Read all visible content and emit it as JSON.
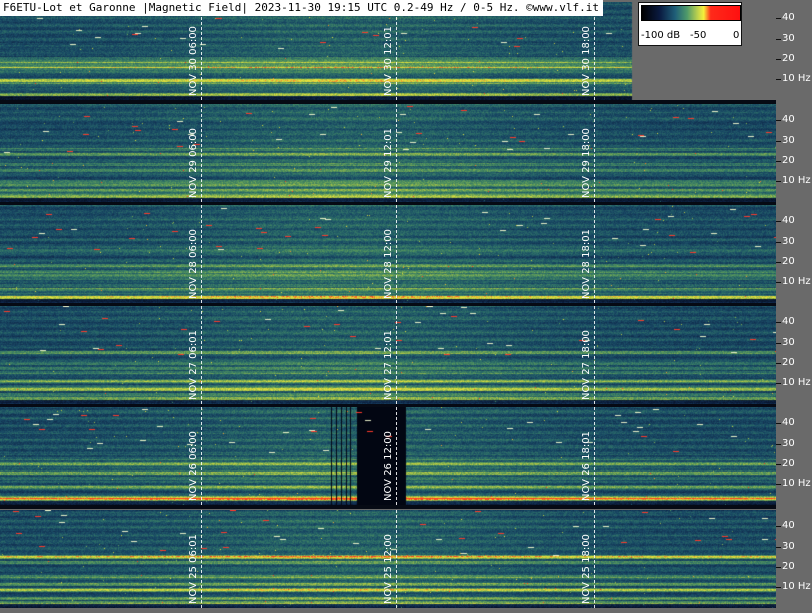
{
  "header": {
    "title": "F6ETU-Lot et Garonne |Magnetic Field| 2023-11-30 19:15 UTC 0.2-49 Hz / 0-5 Hz. ©www.vlf.it"
  },
  "colorbar": {
    "labels": [
      "-100 dB",
      "-50",
      "0"
    ]
  },
  "chart_data": {
    "type": "heatmap",
    "title": "F6ETU-Lot et Garonne |Magnetic Field| 2023-11-30 19:15 UTC 0.2-49 Hz / 0-5 Hz. ©www.vlf.it",
    "y_unit": "Hz",
    "ylim": [
      0,
      49
    ],
    "colorscale_db": [
      -100,
      0
    ],
    "panels": [
      {
        "day": "NOV 30",
        "time_labels": [
          "NOV 30 06:00",
          "NOV 30 12:01",
          "NOV 30 18:00"
        ],
        "y_tick_labels": [
          "40",
          "30",
          "20",
          "10 Hz"
        ],
        "partial": true
      },
      {
        "day": "NOV 29",
        "time_labels": [
          "NOV 29 06:00",
          "NOV 29 12:01",
          "NOV 29 18:00"
        ],
        "y_tick_labels": [
          "40",
          "30",
          "20",
          "10 Hz"
        ]
      },
      {
        "day": "NOV 28",
        "time_labels": [
          "NOV 28 06:00",
          "NOV 28 12:00",
          "NOV 28 18:01"
        ],
        "y_tick_labels": [
          "40",
          "30",
          "20",
          "10 Hz"
        ]
      },
      {
        "day": "NOV 27",
        "time_labels": [
          "NOV 27 06:01",
          "NOV 27 12:01",
          "NOV 27 18:00"
        ],
        "y_tick_labels": [
          "40",
          "30",
          "20",
          "10 Hz"
        ]
      },
      {
        "day": "NOV 26",
        "time_labels": [
          "NOV 26 06:00",
          "NOV 26 12:00",
          "NOV 26 18:01"
        ],
        "y_tick_labels": [
          "40",
          "30",
          "20",
          "10 Hz"
        ],
        "data_gap": true
      },
      {
        "day": "NOV 25",
        "time_labels": [
          "NOV 25 06:01",
          "NOV 25 12:00",
          "NOV 25 18:00"
        ],
        "y_tick_labels": [
          "40",
          "30",
          "20",
          "10 Hz"
        ]
      }
    ]
  }
}
